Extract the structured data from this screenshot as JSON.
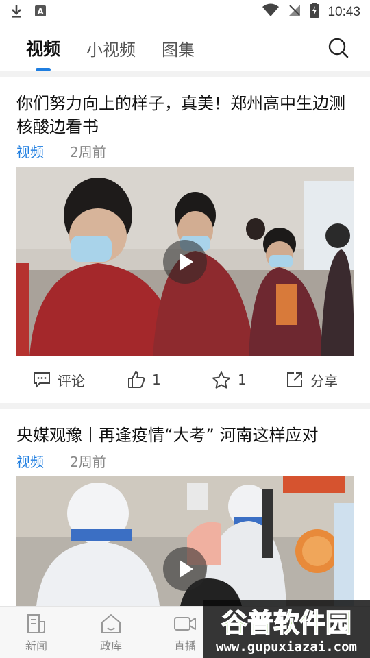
{
  "status": {
    "time": "10:43"
  },
  "tabs": [
    {
      "label": "视频",
      "active": true
    },
    {
      "label": "小视频",
      "active": false
    },
    {
      "label": "图集",
      "active": false
    }
  ],
  "cards": [
    {
      "title": "你们努力向上的样子，真美！郑州高中生边测核酸边看书",
      "category": "视频",
      "time": "2周前",
      "comment_label": "评论",
      "like_count": "1",
      "fav_count": "1",
      "share_label": "分享"
    },
    {
      "title": "央媒观豫丨再逢疫情“大考” 河南这样应对",
      "category": "视频",
      "time": "2周前"
    }
  ],
  "bottom_nav": [
    {
      "label": "新闻",
      "icon": "news-icon"
    },
    {
      "label": "政库",
      "icon": "government-icon"
    },
    {
      "label": "直播",
      "icon": "live-video-icon"
    }
  ],
  "watermark": {
    "brand": "谷普软件园",
    "url": "www.gupuxiazai.com"
  },
  "colors": {
    "accent": "#1f7ee0",
    "separator": "#f2f2f2"
  }
}
